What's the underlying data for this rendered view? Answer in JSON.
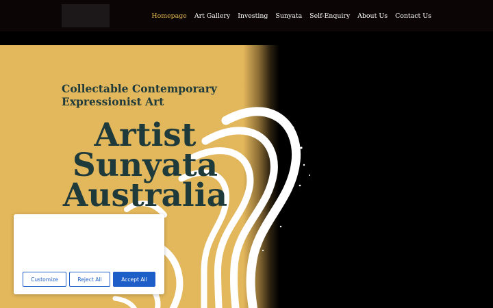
{
  "header": {
    "nav": [
      {
        "label": "Homepage",
        "active": true
      },
      {
        "label": "Art Gallery",
        "active": false
      },
      {
        "label": "Investing",
        "active": false
      },
      {
        "label": "Sunyata",
        "active": false
      },
      {
        "label": "Self-Enquiry",
        "active": false
      },
      {
        "label": "About Us",
        "active": false
      },
      {
        "label": "Contact Us",
        "active": false
      }
    ]
  },
  "hero": {
    "subtitle_line1": "Collectable Contemporary",
    "subtitle_line2": "Expressionist Art",
    "title_line1": "Artist",
    "title_line2": "Sunyata",
    "title_line3": "Australia"
  },
  "cookie_banner": {
    "customize_label": "Customize",
    "reject_label": "Reject All",
    "accept_label": "Accept All"
  },
  "colors": {
    "gold": "#e3b75b",
    "title_teal": "#1f3a3a",
    "nav_active": "#e2b84f",
    "button_blue": "#1e5ec8"
  }
}
